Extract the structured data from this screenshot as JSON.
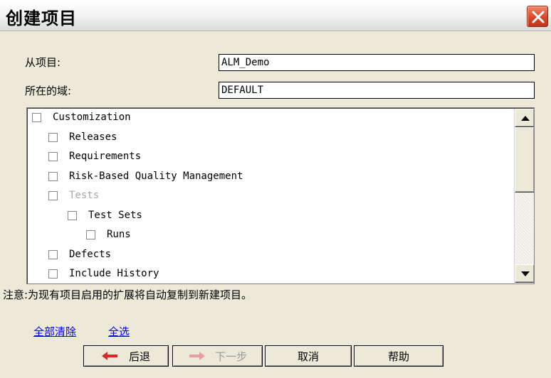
{
  "window": {
    "title": "创建项目",
    "close_icon": "close-icon"
  },
  "form": {
    "from_project_label": "从项目:",
    "from_project_value": "ALM_Demo",
    "domain_label": "所在的域:",
    "domain_value": "DEFAULT"
  },
  "tree": {
    "items": [
      {
        "label": "Customization",
        "checked": false,
        "disabled": false
      },
      {
        "label": "Releases",
        "checked": false,
        "disabled": false
      },
      {
        "label": "Requirements",
        "checked": false,
        "disabled": false
      },
      {
        "label": "Risk-Based Quality Management",
        "checked": false,
        "disabled": false
      },
      {
        "label": "Tests",
        "checked": false,
        "disabled": true
      },
      {
        "label": "Test Sets",
        "checked": false,
        "disabled": false
      },
      {
        "label": "Runs",
        "checked": false,
        "disabled": false
      },
      {
        "label": "Defects",
        "checked": false,
        "disabled": false
      },
      {
        "label": "Include History",
        "checked": false,
        "disabled": false
      }
    ],
    "scroll_up_icon": "triangle-up-icon",
    "scroll_down_icon": "triangle-down-icon"
  },
  "note": "注意:为现有项目启用的扩展将自动复制到新建项目。",
  "links": {
    "clear_all": "全部清除",
    "select_all": "全选"
  },
  "buttons": {
    "back": "后退",
    "back_icon": "arrow-left-icon",
    "next": "下一步",
    "next_icon": "arrow-right-icon",
    "cancel": "取消",
    "help": "帮助"
  },
  "colors": {
    "close_button": "#d8472a",
    "arrow_red": "#d42a2a",
    "link_blue": "#0000ee"
  }
}
